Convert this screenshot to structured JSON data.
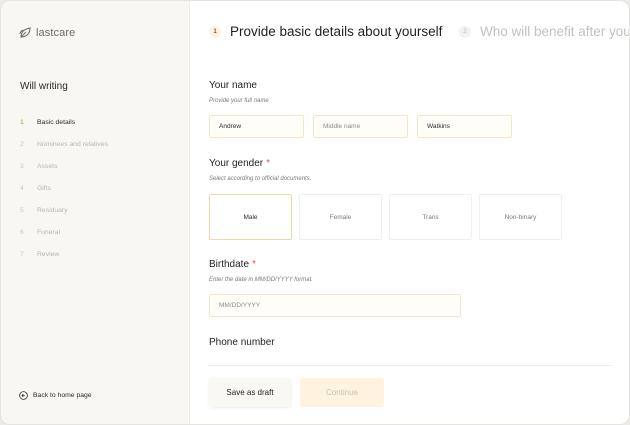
{
  "app": {
    "logo_text": "lastcare"
  },
  "sidebar": {
    "section_title": "Will writing",
    "steps": [
      {
        "num": "1",
        "label": "Basic details",
        "active": true
      },
      {
        "num": "2",
        "label": "Nominees and relatives"
      },
      {
        "num": "3",
        "label": "Assets"
      },
      {
        "num": "4",
        "label": "Gifts"
      },
      {
        "num": "5",
        "label": "Residuary"
      },
      {
        "num": "6",
        "label": "Funeral"
      },
      {
        "num": "7",
        "label": "Review"
      }
    ],
    "back_label": "Back to home page"
  },
  "header": {
    "current": {
      "num": "1",
      "title": "Provide basic details about yourself"
    },
    "next": {
      "num": "2",
      "title": "Who will benefit after you"
    }
  },
  "form": {
    "name": {
      "label": "Your name",
      "hint": "Provide your full name",
      "first_value": "Andrew",
      "middle_placeholder": "Middle name",
      "last_value": "Watkins"
    },
    "gender": {
      "label": "Your gender",
      "required_mark": "*",
      "hint": "Select according to official documents.",
      "options": [
        "Male",
        "Female",
        "Trans",
        "Non-binary"
      ],
      "selected": "Male"
    },
    "birthdate": {
      "label": "Birthdate",
      "required_mark": "*",
      "hint": "Enter the date in MM/DD/YYYY format.",
      "placeholder": "MM/DD/YYYY"
    },
    "phone": {
      "label": "Phone number"
    }
  },
  "footer": {
    "draft_label": "Save as draft",
    "continue_label": "Continue"
  },
  "colors": {
    "accent": "#c58a2a",
    "accent_soft": "#fdf3de",
    "sidebar_bg": "#f8f7f3",
    "required": "#e05757"
  }
}
